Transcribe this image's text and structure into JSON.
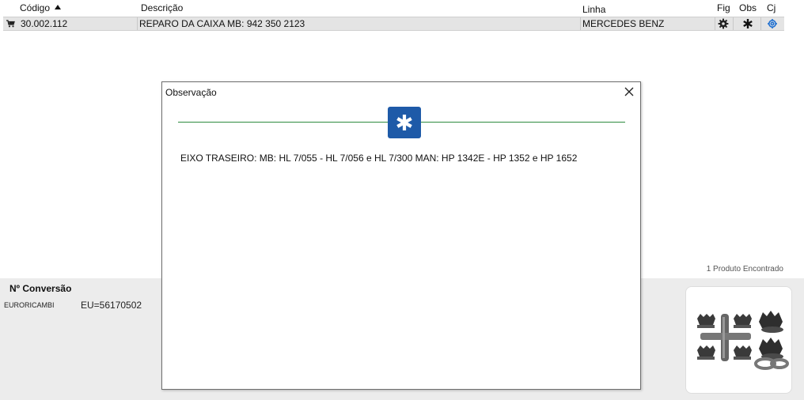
{
  "header": {
    "codigo": "Código",
    "descricao": "Descrição",
    "linha": "Linha",
    "fig": "Fig",
    "obs": "Obs",
    "cj": "Cj"
  },
  "row": {
    "codigo": "30.002.112",
    "descricao": "REPARO DA CAIXA MB: 942 350 2123",
    "linha": "MERCEDES BENZ",
    "icons": [
      "cart-icon",
      "gear-icon",
      "asterisk-icon",
      "link-icon"
    ]
  },
  "results": {
    "count_text": "1 Produto Encontrado"
  },
  "conversion": {
    "title": "Nº Conversão",
    "brand": "EURORICAMBI",
    "code": "EU=56170502"
  },
  "dialog": {
    "title": "Observação",
    "text": "EIXO TRASEIRO: MB: HL 7/055 - HL 7/056 e HL 7/300 MAN: HP 1342E - HP 1352 e HP 1652"
  },
  "colors": {
    "row_bg": "#e4e4e4",
    "accent_blue": "#1e5aa8",
    "divider_green": "#2e8b3e",
    "panel_bg": "#ececec"
  }
}
